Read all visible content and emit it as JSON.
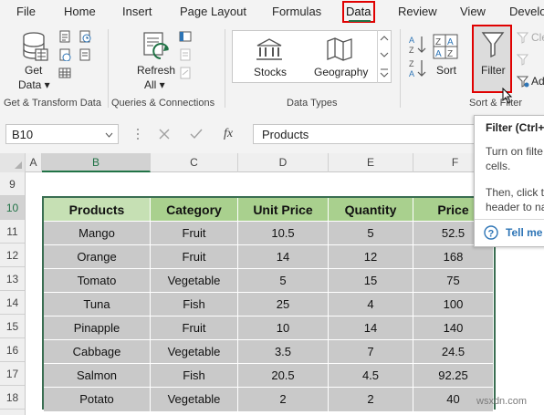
{
  "menu": {
    "items": [
      "File",
      "Home",
      "Insert",
      "Page Layout",
      "Formulas",
      "Data",
      "Review",
      "View",
      "Develo"
    ]
  },
  "ribbon": {
    "get_data": {
      "line1": "Get",
      "line2": "Data ▾"
    },
    "refresh_all": {
      "line1": "Refresh",
      "line2": "All ▾"
    },
    "stocks": "Stocks",
    "geography": "Geography",
    "sort": "Sort",
    "filter": "Filter",
    "clear": "Cle",
    "advanced": "Ad",
    "groups": {
      "get_transform": "Get & Transform Data",
      "queries": "Queries & Connections",
      "data_types": "Data Types",
      "sort_filter": "Sort & Filter"
    }
  },
  "formula_bar": {
    "name_box": "B10",
    "fx": "fx",
    "value": "Products"
  },
  "tooltip": {
    "title": "Filter (Ctrl+",
    "line1": "Turn on filte",
    "line2": "cells.",
    "line3": "Then, click t",
    "line4": "header to na",
    "link": "Tell me"
  },
  "grid": {
    "columns": [
      "A",
      "B",
      "C",
      "D",
      "E",
      "F"
    ],
    "rows": [
      "9",
      "10",
      "11",
      "12",
      "13",
      "14",
      "15",
      "16",
      "17",
      "18"
    ]
  },
  "table": {
    "headers": [
      "Products",
      "Category",
      "Unit Price",
      "Quantity",
      "Price"
    ],
    "rows": [
      [
        "Mango",
        "Fruit",
        "10.5",
        "5",
        "52.5"
      ],
      [
        "Orange",
        "Fruit",
        "14",
        "12",
        "168"
      ],
      [
        "Tomato",
        "Vegetable",
        "5",
        "15",
        "75"
      ],
      [
        "Tuna",
        "Fish",
        "25",
        "4",
        "100"
      ],
      [
        "Pinapple",
        "Fruit",
        "10",
        "14",
        "140"
      ],
      [
        "Cabbage",
        "Vegetable",
        "3.5",
        "7",
        "24.5"
      ],
      [
        "Salmon",
        "Fish",
        "20.5",
        "4.5",
        "92.25"
      ],
      [
        "Potato",
        "Vegetable",
        "2",
        "2",
        "40"
      ]
    ]
  },
  "watermark": "wsxdn.com",
  "colors": {
    "excel_green": "#217346",
    "highlight_red": "#e00000",
    "header_green": "#a9d08e",
    "header_light_green": "#c6e0b4",
    "cell_gray": "#c9c9c9"
  }
}
